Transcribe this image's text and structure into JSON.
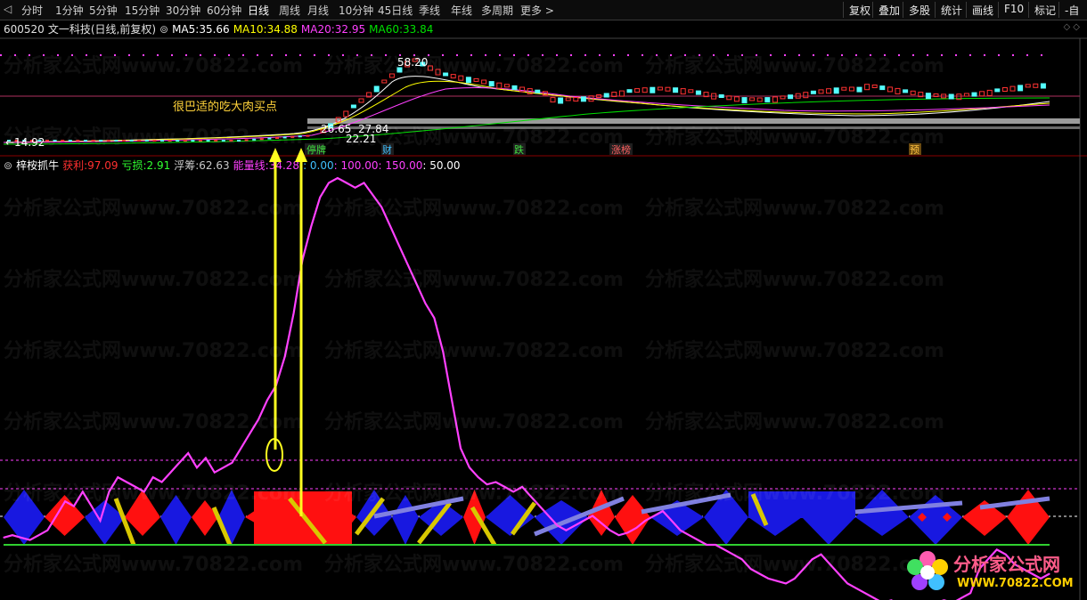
{
  "toolbar": {
    "back_glyph": "◁",
    "periods": [
      "分时",
      "1分钟",
      "5分钟",
      "15分钟",
      "30分钟",
      "60分钟",
      "日线",
      "周线",
      "月线",
      "10分钟",
      "45日线",
      "季线",
      "年线",
      "多周期",
      "更多 >"
    ],
    "active_period": "日线",
    "right_buttons": [
      "复权",
      "叠加",
      "多股",
      "统计",
      "画线",
      "F10",
      "标记",
      "-自"
    ]
  },
  "stock": {
    "code": "600520",
    "name": "文一科技",
    "period_label": "(日线,前复权)",
    "ma5_label": "MA5:",
    "ma5": "35.66",
    "ma10_label": "MA10:",
    "ma10": "34.88",
    "ma20_label": "MA20:",
    "ma20": "32.95",
    "ma60_label": "MA60:",
    "ma60": "33.84"
  },
  "price_chart": {
    "high_label": "58.20",
    "low_label": "←14.92",
    "cluster_labels": [
      "26.65",
      "27.84",
      "22.21"
    ],
    "annotation": "很巴适的吃大肉买点",
    "event_tags": [
      "停牌",
      "财",
      "跌",
      "涨榜",
      "预"
    ]
  },
  "indicator": {
    "name": "梓桉抓牛",
    "profit_label": "获利:",
    "profit": "97.09",
    "loss_label": "亏损:",
    "loss": "2.91",
    "float_label": "浮筹:",
    "float": "62.63",
    "energy_label": "能量线:",
    "energy": "34.28",
    "levels": [
      ": 0.00",
      ": 100.00",
      ": 150.00",
      ": 50.00"
    ]
  },
  "watermark": {
    "text": "分析家公式网www.70822.com",
    "logo_line1": "分析家公式网",
    "logo_line2": "WWW.70822.COM"
  },
  "colors": {
    "up": "#ff3232",
    "down": "#54ffff",
    "ma5": "#ffffff",
    "ma10": "#ffff00",
    "ma20": "#ff40ff",
    "ma60": "#00e000",
    "energy": "#ff40ff",
    "band_red": "#ff1010",
    "band_blue": "#1818e0",
    "band_yellow": "#d8c800",
    "band_lavender": "#8080e0"
  },
  "chart_data": {
    "type": "line",
    "x_count": 120,
    "series": [
      {
        "name": "能量线",
        "values": [
          3,
          4,
          3,
          2,
          4,
          6,
          12,
          18,
          16,
          22,
          16,
          10,
          22,
          28,
          26,
          24,
          22,
          28,
          26,
          30,
          34,
          38,
          32,
          36,
          30,
          32,
          34,
          40,
          46,
          52,
          60,
          66,
          78,
          96,
          118,
          132,
          144,
          150,
          152,
          150,
          148,
          150,
          145,
          140,
          132,
          124,
          116,
          108,
          100,
          94,
          80,
          60,
          40,
          32,
          28,
          25,
          26,
          24,
          22,
          24,
          20,
          16,
          12,
          8,
          6,
          8,
          10,
          12,
          9,
          6,
          4,
          5,
          7,
          10,
          12,
          14,
          10,
          6,
          4,
          2,
          0,
          0,
          -2,
          -4,
          -6,
          -10,
          -12,
          -14,
          -15,
          -16,
          -14,
          -10,
          -6,
          -4,
          -8,
          -12,
          -16,
          -18,
          -20,
          -22,
          -24,
          -23,
          -25,
          -24,
          -26,
          -25,
          -24,
          -23,
          -24,
          -22,
          -20,
          -10,
          -6,
          -2,
          -4,
          -8,
          -10,
          -12,
          -14,
          -12
        ]
      }
    ]
  }
}
